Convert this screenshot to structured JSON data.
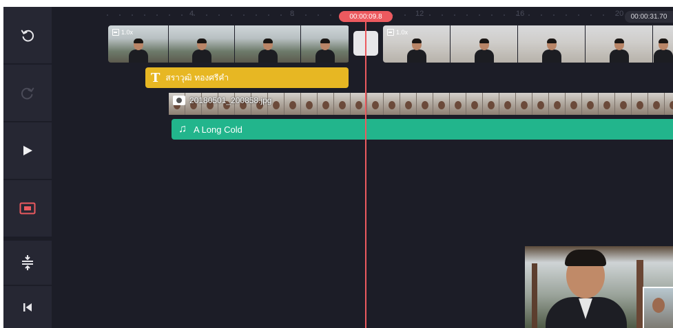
{
  "toolbar": {
    "items": [
      {
        "name": "undo",
        "icon": "undo-icon"
      },
      {
        "name": "redo",
        "icon": "redo-icon",
        "disabled": true
      },
      {
        "name": "play",
        "icon": "play-icon"
      },
      {
        "name": "preview-mode",
        "icon": "preview-screen-icon",
        "color": "#ec5a5f"
      },
      {
        "name": "track-adjust",
        "icon": "expand-tracks-icon"
      },
      {
        "name": "skip-start",
        "icon": "skip-to-start-icon"
      }
    ]
  },
  "timeline": {
    "ruler_labels": [
      "4",
      "8",
      "12",
      "16",
      "20"
    ],
    "current_time": "00:00:09.8",
    "total_time": "00:00:31.70",
    "playhead_color": "#ec5a5f"
  },
  "clips": [
    {
      "speed": "1.0x"
    },
    {
      "speed": "1.0x"
    }
  ],
  "layers": {
    "text": {
      "label": "สราวุฒิ ทองศรีคำ",
      "icon": "T",
      "color": "#e7b723"
    },
    "image": {
      "label": "20180501_200858.jpg",
      "icon": "camera-icon"
    },
    "audio": {
      "label": "A Long Cold",
      "icon": "♫",
      "color": "#22b58c"
    }
  }
}
